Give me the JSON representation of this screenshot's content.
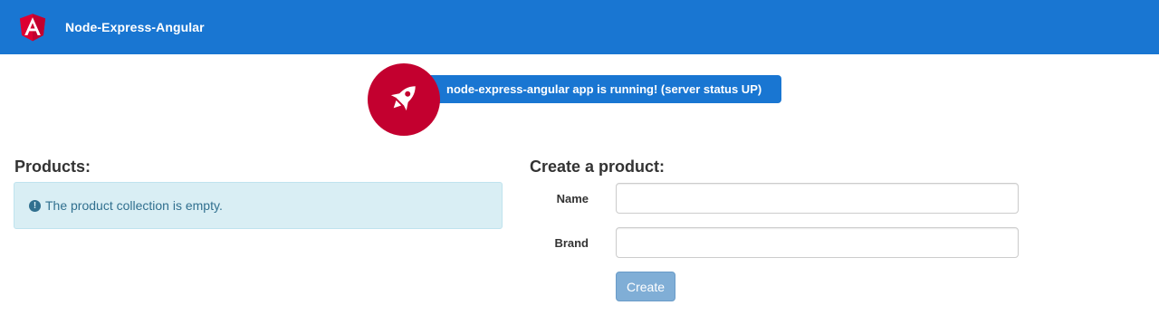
{
  "toolbar": {
    "app_title": "Node-Express-Angular",
    "logo_icon": "angular-logo-icon",
    "background": "#1976d2"
  },
  "status": {
    "message": "node-express-angular app is running! (server status UP)",
    "icon": "rocket-icon",
    "icon_background": "#c3002f"
  },
  "products": {
    "title": "Products:",
    "empty_message": "The product collection is empty.",
    "empty_icon": "info-circle-icon"
  },
  "create_product": {
    "title": "Create a product:",
    "name_label": "Name",
    "name_value": "",
    "brand_label": "Brand",
    "brand_value": "",
    "submit_label": "Create"
  }
}
